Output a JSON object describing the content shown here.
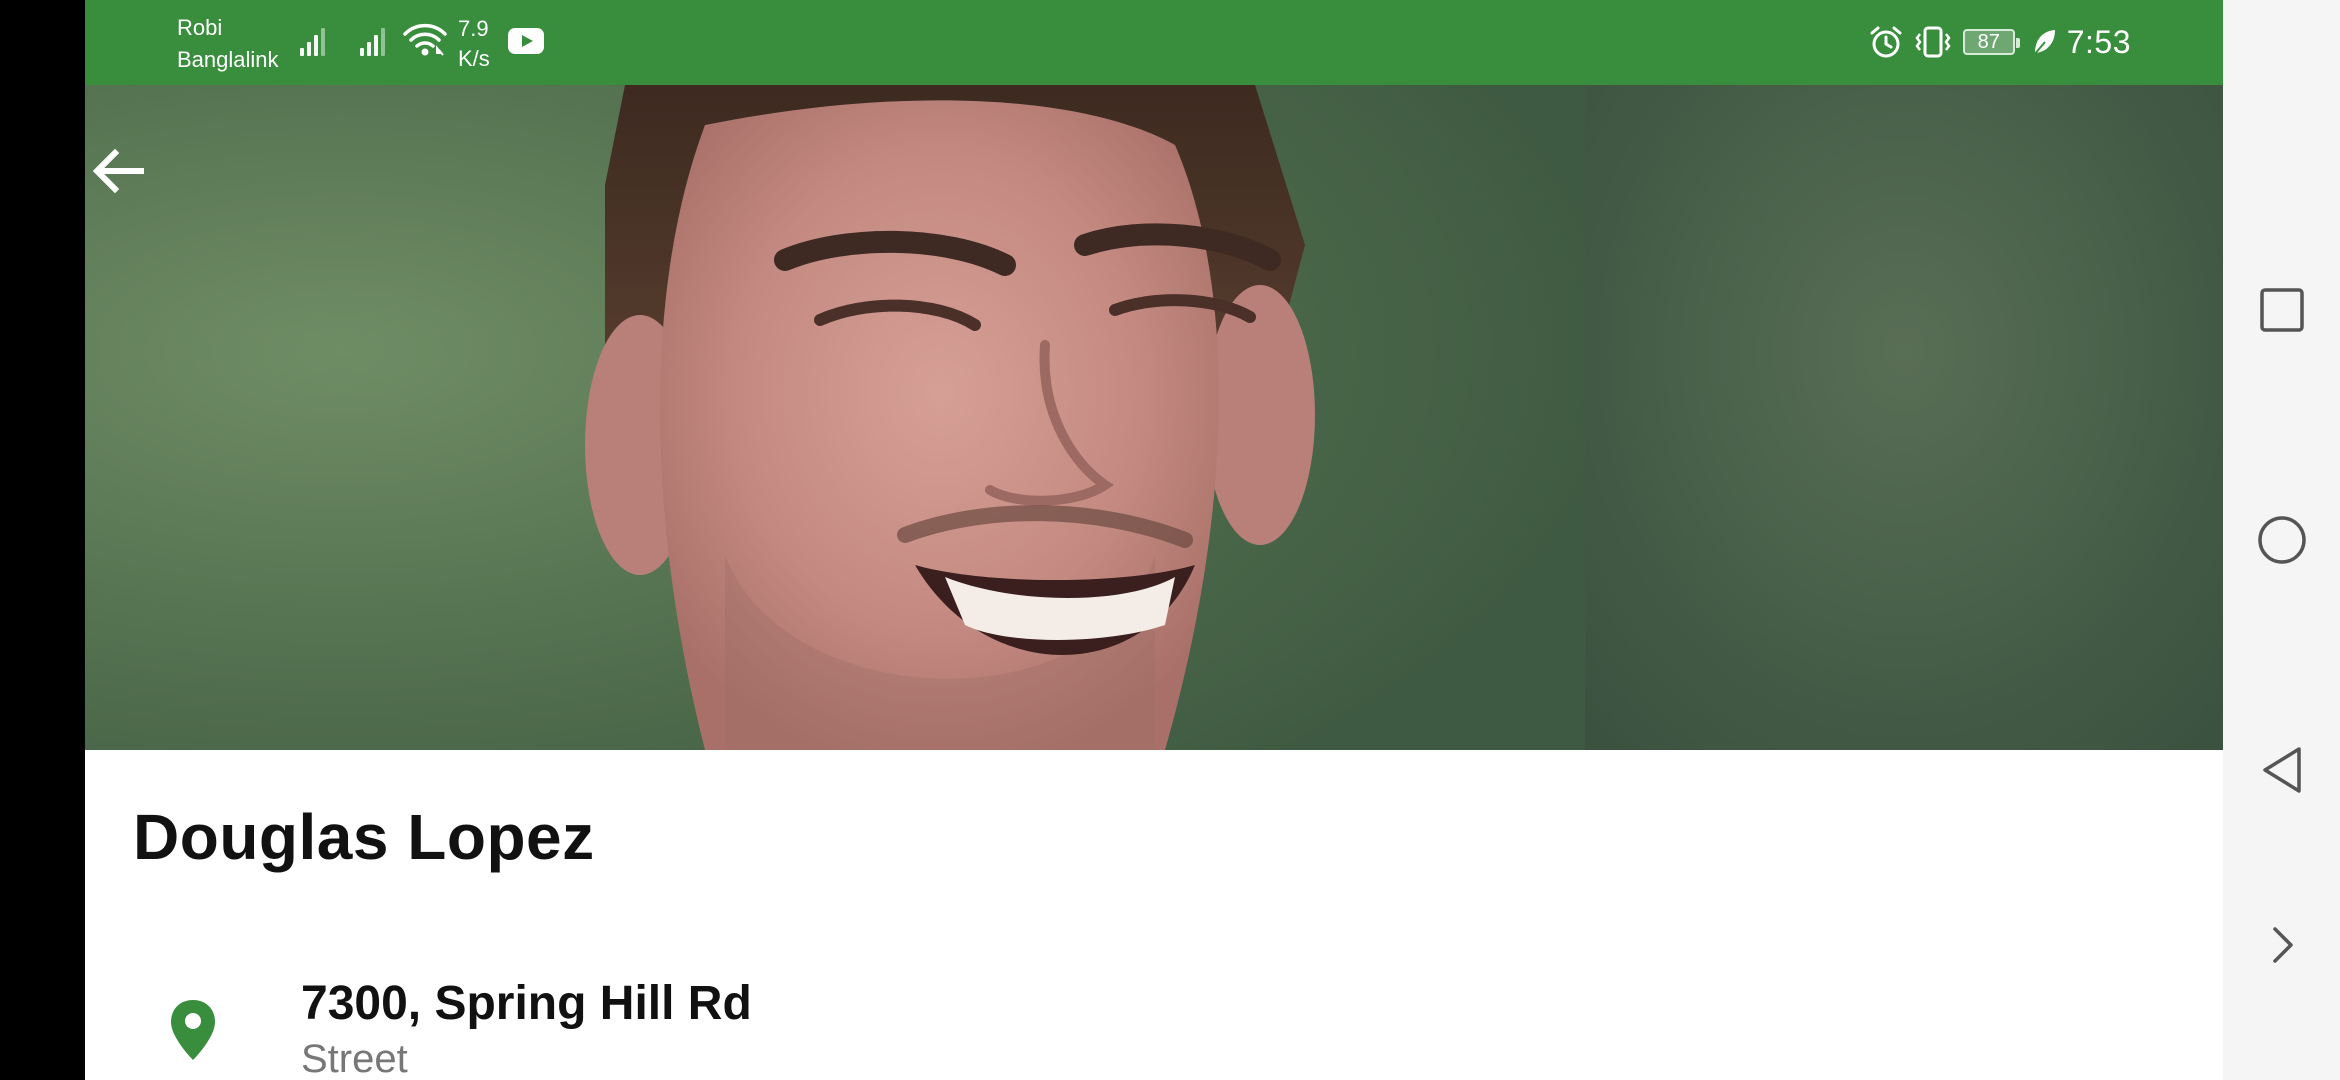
{
  "status_bar": {
    "carrier_line1": "Robi",
    "carrier_line2": "Banglalink",
    "speed_value": "7.9",
    "speed_unit": "K/s",
    "battery": "87",
    "time": "7:53",
    "icons": [
      "signal-icon",
      "signal-icon",
      "wifi-icon",
      "youtube-icon",
      "alarm-icon",
      "vibrate-icon",
      "battery-icon",
      "leaf-icon"
    ]
  },
  "contact": {
    "name": "Douglas Lopez",
    "address": "7300, Spring Hill Rd",
    "address_type": "Street"
  },
  "colors": {
    "primary": "#388e3c",
    "location_icon": "#388e3c"
  },
  "nav_bar": {
    "buttons": [
      "recents-square-icon",
      "home-circle-icon",
      "back-triangle-icon",
      "chevron-right-icon"
    ]
  }
}
